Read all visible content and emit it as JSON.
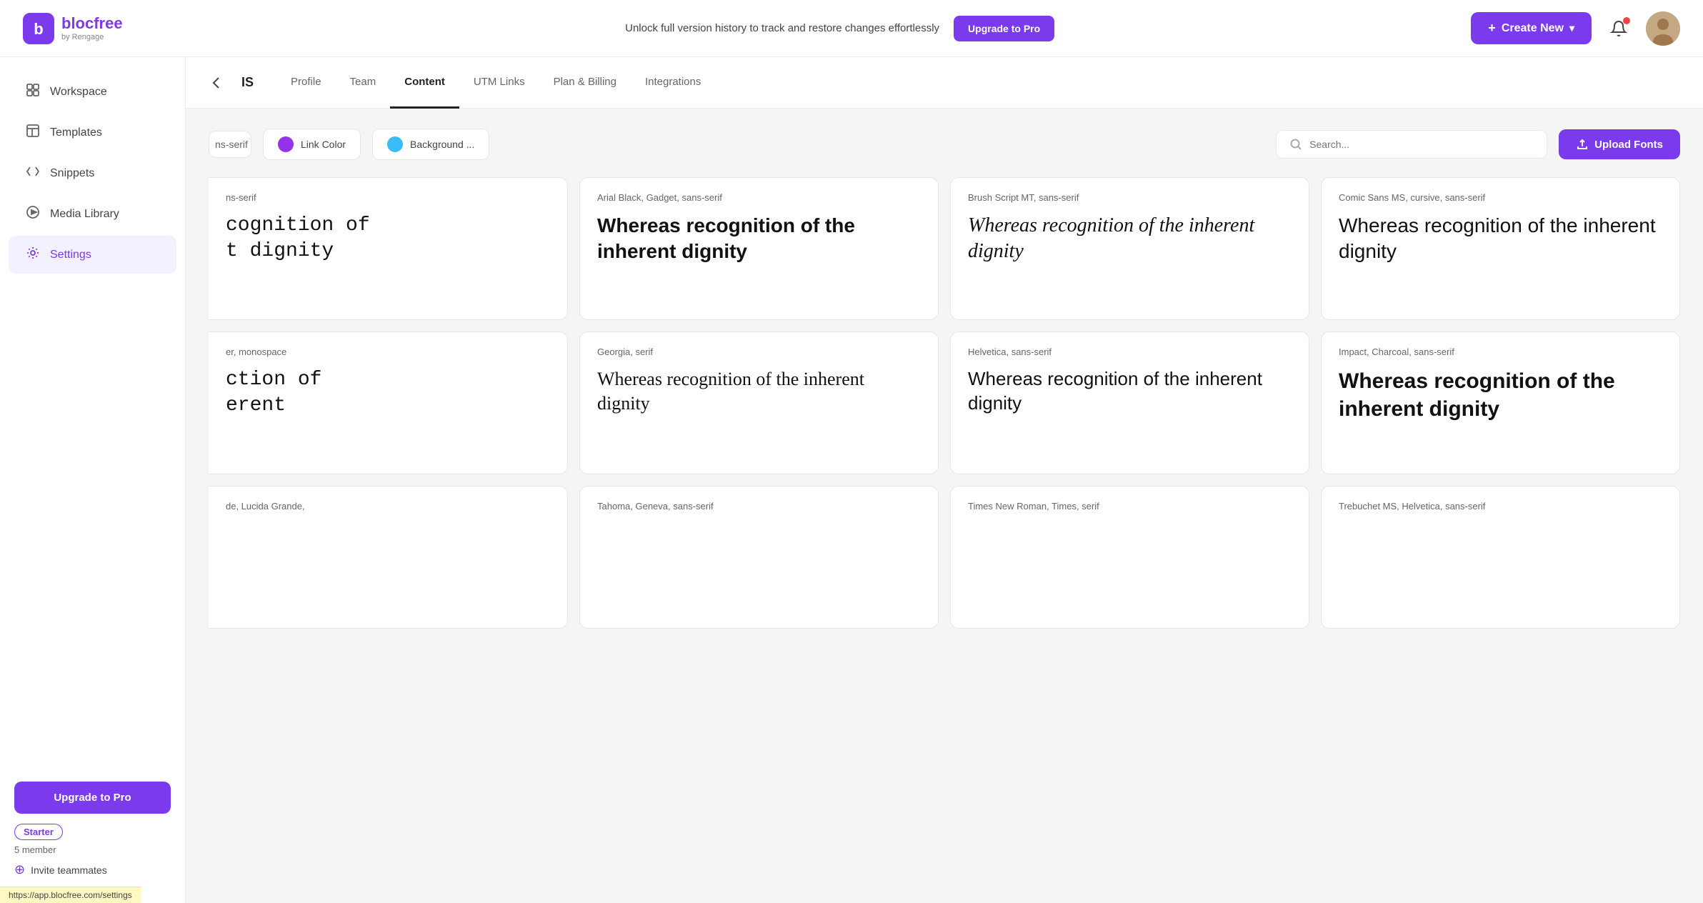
{
  "header": {
    "logo_main": "blocfree",
    "logo_sub": "by Rengage",
    "promo_text": "Unlock full version history to track and restore changes effortlessly",
    "upgrade_pro_label": "Upgrade to Pro",
    "create_new_label": "Create New"
  },
  "sidebar": {
    "items": [
      {
        "id": "workspace",
        "label": "Workspace",
        "icon": "⬜"
      },
      {
        "id": "templates",
        "label": "Templates",
        "icon": "📄"
      },
      {
        "id": "snippets",
        "label": "Snippets",
        "icon": "⟨⟩"
      },
      {
        "id": "media-library",
        "label": "Media Library",
        "icon": "▶"
      },
      {
        "id": "settings",
        "label": "Settings",
        "icon": "⚙"
      }
    ],
    "upgrade_label": "Upgrade to Pro",
    "starter_badge": "Starter",
    "member_count": "5 member",
    "invite_label": "Invite teammates"
  },
  "settings": {
    "title": "IS",
    "tabs": [
      {
        "id": "profile",
        "label": "Profile",
        "active": false
      },
      {
        "id": "team",
        "label": "Team",
        "active": false
      },
      {
        "id": "content",
        "label": "Content",
        "active": true
      },
      {
        "id": "utm-links",
        "label": "UTM Links",
        "active": false
      },
      {
        "id": "plan-billing",
        "label": "Plan & Billing",
        "active": false
      },
      {
        "id": "integrations",
        "label": "Integrations",
        "active": false
      }
    ]
  },
  "fonts_toolbar": {
    "link_color_label": "Link Color",
    "link_color_hex": "#9333ea",
    "background_label": "Background ...",
    "background_color_hex": "#38bdf8",
    "search_placeholder": "Search...",
    "upload_fonts_label": "Upload Fonts"
  },
  "font_cards": [
    {
      "id": "arial-black",
      "family_label": "Arial Black, Gadget, sans-serif",
      "preview_text": "Whereas recognition of the inherent dignity",
      "css_class": "preview-arial-black",
      "partial": true
    },
    {
      "id": "arial-black2",
      "family_label": "Arial Black, Gadget, sans-serif",
      "preview_text": "Whereas recognition of the inherent dignity",
      "css_class": "preview-arial-black"
    },
    {
      "id": "brush-script",
      "family_label": "Brush Script MT, sans-serif",
      "preview_text": "Whereas recognition of the inherent dignity",
      "css_class": "preview-brush"
    },
    {
      "id": "comic-sans",
      "family_label": "Comic Sans MS, cursive, sans-serif",
      "preview_text": "Whereas recognition of the inherent dignity",
      "css_class": "preview-comic"
    },
    {
      "id": "courier",
      "family_label": "Courier, monospace",
      "preview_text": "ction of the inherent",
      "css_class": "preview-courier",
      "partial": true
    },
    {
      "id": "georgia",
      "family_label": "Georgia, serif",
      "preview_text": "Whereas recognition of the inherent dignity",
      "css_class": "preview-georgia"
    },
    {
      "id": "helvetica",
      "family_label": "Helvetica, sans-serif",
      "preview_text": "Whereas recognition of the inherent dignity",
      "css_class": "preview-helvetica"
    },
    {
      "id": "impact",
      "family_label": "Impact, Charcoal, sans-serif",
      "preview_text": "Whereas recognition of the inherent dignity",
      "css_class": "preview-impact"
    },
    {
      "id": "tahoma",
      "family_label": "Tahoma, Geneva, sans-serif",
      "preview_text": "",
      "css_class": "preview-tahoma",
      "partial": true
    },
    {
      "id": "tahoma2",
      "family_label": "Tahoma, Geneva, sans-serif",
      "preview_text": "",
      "css_class": "preview-tahoma"
    },
    {
      "id": "times",
      "family_label": "Times New Roman, Times, serif",
      "preview_text": "",
      "css_class": "preview-times"
    },
    {
      "id": "trebuchet",
      "family_label": "Trebuchet MS, Helvetica, sans-serif",
      "preview_text": "",
      "css_class": "preview-trebuchet"
    }
  ],
  "tooltip": {
    "url": "https://app.blocfree.com/settings"
  }
}
